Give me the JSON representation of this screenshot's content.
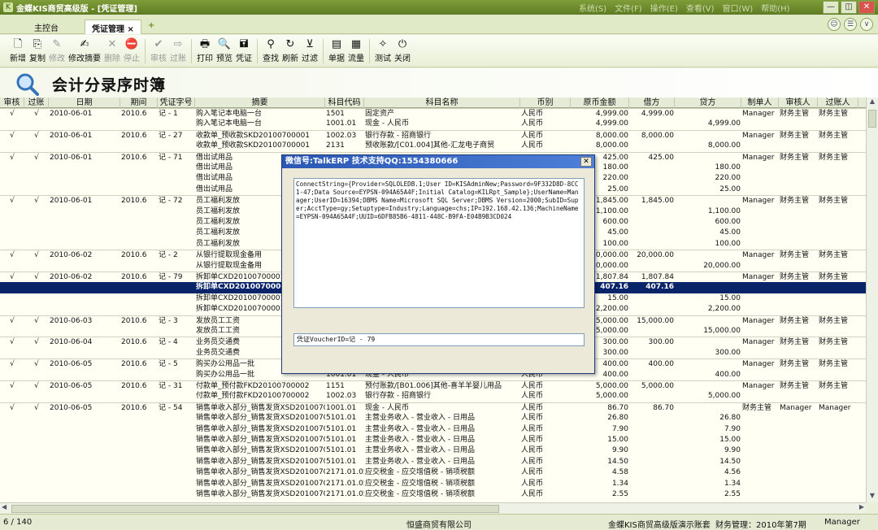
{
  "app": {
    "title": "金蝶KIS商贸高级版 - [凭证管理]",
    "logo": "K",
    "menus": [
      "系统(S)",
      "文件(F)",
      "操作(E)",
      "查看(V)",
      "窗口(W)",
      "帮助(H)"
    ],
    "win_buttons": [
      "—",
      "◫",
      "✕"
    ]
  },
  "tabs": [
    {
      "label": "主控台"
    },
    {
      "label": "凭证管理 ×"
    },
    {
      "label": "+"
    }
  ],
  "tab_icons": [
    "☺",
    "☰",
    "∨"
  ],
  "toolbar": [
    {
      "icon": "🗋",
      "label": "新增",
      "enabled": true
    },
    {
      "icon": "⎘",
      "label": "复制",
      "enabled": true
    },
    {
      "icon": "✎",
      "label": "修改",
      "enabled": false
    },
    {
      "icon": "✍",
      "label": "修改摘要",
      "enabled": true
    },
    {
      "icon": "✕",
      "label": "删除",
      "enabled": false
    },
    {
      "icon": "⛔",
      "label": "停止",
      "enabled": false
    },
    {
      "icon": "✔",
      "label": "审核",
      "enabled": false
    },
    {
      "icon": "⇨",
      "label": "过账",
      "enabled": false
    },
    {
      "icon": "🖶",
      "label": "打印",
      "enabled": true
    },
    {
      "icon": "🔍",
      "label": "预览",
      "enabled": true
    },
    {
      "icon": "🖬",
      "label": "凭证",
      "enabled": true
    },
    {
      "icon": "⚲",
      "label": "查找",
      "enabled": true
    },
    {
      "icon": "↻",
      "label": "刷新",
      "enabled": true
    },
    {
      "icon": "⊻",
      "label": "过滤",
      "enabled": true
    },
    {
      "icon": "▤",
      "label": "单据",
      "enabled": true
    },
    {
      "icon": "▦",
      "label": "流量",
      "enabled": true
    },
    {
      "icon": "✧",
      "label": "测试",
      "enabled": true
    },
    {
      "icon": "⏻",
      "label": "关闭",
      "enabled": true
    }
  ],
  "page_title": "会计分录序时簿",
  "columns": [
    "审核",
    "过账",
    "日期",
    "期间",
    "凭证字号",
    "摘要",
    "科目代码",
    "科目名称",
    "币别",
    "原币金额",
    "借方",
    "贷方",
    "制单人",
    "审核人",
    "过账人"
  ],
  "rows": [
    {
      "sep": true,
      "audit": "√",
      "post": "√",
      "date": "2010-06-01",
      "period": "2010.6",
      "voucher": "记 - 1",
      "summary": "购入笔记本电脑一台",
      "code": "1501",
      "name": "固定资产",
      "cur": "人民币",
      "amount": "4,999.00",
      "debit": "4,999.00",
      "credit": "",
      "maker": "Manager",
      "auditor": "财务主管",
      "poster": "财务主管"
    },
    {
      "summary": "购入笔记本电脑一台",
      "code": "1001.01",
      "name": "现金 - 人民币",
      "cur": "人民币",
      "amount": "4,999.00",
      "credit": "4,999.00"
    },
    {
      "sep": true,
      "audit": "√",
      "post": "√",
      "date": "2010-06-01",
      "period": "2010.6",
      "voucher": "记 - 27",
      "summary": "收款单_预收款SKD20100700001",
      "code": "1002.03",
      "name": "银行存款 - 招商银行",
      "cur": "人民币",
      "amount": "8,000.00",
      "debit": "8,000.00",
      "maker": "Manager",
      "auditor": "财务主管",
      "poster": "财务主管"
    },
    {
      "summary": "收款单_预收款SKD20100700001",
      "code": "2131",
      "name": "预收账款/[C01.004]其他-汇龙电子商贸",
      "cur": "人民币",
      "amount": "8,000.00",
      "credit": "8,000.00"
    },
    {
      "sep": true,
      "audit": "√",
      "post": "√",
      "date": "2010-06-01",
      "period": "2010.6",
      "voucher": "记 - 71",
      "summary": "借出试用品",
      "amount": "425.00",
      "debit": "425.00",
      "maker": "Manager",
      "auditor": "财务主管",
      "poster": "财务主管"
    },
    {
      "summary": "借出试用品",
      "amount": "180.00",
      "credit": "180.00"
    },
    {
      "summary": "借出试用品",
      "amount": "220.00",
      "credit": "220.00"
    },
    {
      "summary": "借出试用品",
      "amount": "25.00",
      "credit": "25.00"
    },
    {
      "sep": true,
      "audit": "√",
      "post": "√",
      "date": "2010-06-01",
      "period": "2010.6",
      "voucher": "记 - 72",
      "summary": "员工福利发放",
      "amount": "1,845.00",
      "debit": "1,845.00",
      "maker": "Manager",
      "auditor": "财务主管",
      "poster": "财务主管"
    },
    {
      "summary": "员工福利发放",
      "amount": "1,100.00",
      "credit": "1,100.00"
    },
    {
      "summary": "员工福利发放",
      "amount": "600.00",
      "credit": "600.00"
    },
    {
      "summary": "员工福利发放",
      "amount": "45.00",
      "credit": "45.00"
    },
    {
      "summary": "员工福利发放",
      "amount": "100.00",
      "credit": "100.00"
    },
    {
      "sep": true,
      "audit": "√",
      "post": "√",
      "date": "2010-06-02",
      "period": "2010.6",
      "voucher": "记 - 2",
      "summary": "从银行提取现金备用",
      "amount": "20,000.00",
      "debit": "20,000.00",
      "maker": "Manager",
      "auditor": "财务主管",
      "poster": "财务主管"
    },
    {
      "summary": "从银行提取现金备用",
      "amount": "20,000.00",
      "credit": "20,000.00"
    },
    {
      "sep": true,
      "audit": "√",
      "post": "√",
      "date": "2010-06-02",
      "period": "2010.6",
      "voucher": "记 - 79",
      "summary": "拆卸单CXD20100700001",
      "amount": "1,807.84",
      "debit": "1,807.84",
      "maker": "Manager",
      "auditor": "财务主管",
      "poster": "财务主管"
    },
    {
      "sel": true,
      "summary": "拆卸单CXD20100700001",
      "amount": "407.16",
      "debit": "407.16"
    },
    {
      "summary": "拆卸单CXD20100700001",
      "amount": "15.00",
      "credit": "15.00"
    },
    {
      "summary": "拆卸单CXD20100700001",
      "amount": "2,200.00",
      "credit": "2,200.00"
    },
    {
      "sep": true,
      "audit": "√",
      "post": "√",
      "date": "2010-06-03",
      "period": "2010.6",
      "voucher": "记 - 3",
      "summary": "发放员工工资",
      "amount": "15,000.00",
      "debit": "15,000.00",
      "maker": "Manager",
      "auditor": "财务主管",
      "poster": "财务主管"
    },
    {
      "summary": "发放员工工资",
      "amount": "15,000.00",
      "credit": "15,000.00"
    },
    {
      "sep": true,
      "audit": "√",
      "post": "√",
      "date": "2010-06-04",
      "period": "2010.6",
      "voucher": "记 - 4",
      "summary": "业务员交通费",
      "amount": "300.00",
      "debit": "300.00",
      "maker": "Manager",
      "auditor": "财务主管",
      "poster": "财务主管"
    },
    {
      "summary": "业务员交通费",
      "amount": "300.00",
      "credit": "300.00"
    },
    {
      "sep": true,
      "audit": "√",
      "post": "√",
      "date": "2010-06-05",
      "period": "2010.6",
      "voucher": "记 - 5",
      "summary": "购买办公用品一批",
      "amount": "400.00",
      "debit": "400.00",
      "maker": "Manager",
      "auditor": "财务主管",
      "poster": "财务主管"
    },
    {
      "summary": "购买办公用品一批",
      "code": "1001.01",
      "name": "现金 - 人民币",
      "cur": "人民币",
      "amount": "400.00",
      "credit": "400.00"
    },
    {
      "sep": true,
      "audit": "√",
      "post": "√",
      "date": "2010-06-05",
      "period": "2010.6",
      "voucher": "记 - 31",
      "summary": "付款单_预付款FKD20100700002",
      "code": "1151",
      "name": "预付账款/[B01.006]其他-喜羊羊婴儿用品",
      "cur": "人民币",
      "amount": "5,000.00",
      "debit": "5,000.00",
      "maker": "Manager",
      "auditor": "财务主管",
      "poster": "财务主管"
    },
    {
      "summary": "付款单_预付款FKD20100700002",
      "code": "1002.03",
      "name": "银行存款 - 招商银行",
      "cur": "人民币",
      "amount": "5,000.00",
      "credit": "5,000.00"
    },
    {
      "sep": true,
      "audit": "√",
      "post": "√",
      "date": "2010-06-05",
      "period": "2010.6",
      "voucher": "记 - 54",
      "summary": "销售单收入部分_销售发货XSD20100700001",
      "code": "1001.01",
      "name": "现金 - 人民币",
      "cur": "人民币",
      "amount": "86.70",
      "debit": "86.70",
      "maker": "财务主管",
      "auditor": "Manager",
      "poster": "Manager"
    },
    {
      "summary": "销售单收入部分_销售发货XSD20100700001",
      "code": "5101.01",
      "name": "主营业务收入 - 营业收入 - 日用品",
      "cur": "人民币",
      "amount": "26.80",
      "credit": "26.80"
    },
    {
      "summary": "销售单收入部分_销售发货XSD20100700001",
      "code": "5101.01",
      "name": "主营业务收入 - 营业收入 - 日用品",
      "cur": "人民币",
      "amount": "7.90",
      "credit": "7.90"
    },
    {
      "summary": "销售单收入部分_销售发货XSD20100700001",
      "code": "5101.01",
      "name": "主营业务收入 - 营业收入 - 日用品",
      "cur": "人民币",
      "amount": "15.00",
      "credit": "15.00"
    },
    {
      "summary": "销售单收入部分_销售发货XSD20100700001",
      "code": "5101.01",
      "name": "主营业务收入 - 营业收入 - 日用品",
      "cur": "人民币",
      "amount": "9.90",
      "credit": "9.90"
    },
    {
      "summary": "销售单收入部分_销售发货XSD20100700001",
      "code": "5101.01",
      "name": "主营业务收入 - 营业收入 - 日用品",
      "cur": "人民币",
      "amount": "14.50",
      "credit": "14.50"
    },
    {
      "summary": "销售单收入部分_销售发货XSD20100700001",
      "code": "2171.01.05",
      "name": "应交税金 - 应交增值税 - 销项税额",
      "cur": "人民币",
      "amount": "4.58",
      "credit": "4.56"
    },
    {
      "summary": "销售单收入部分_销售发货XSD20100700001",
      "code": "2171.01.05",
      "name": "应交税金 - 应交增值税 - 销项税额",
      "cur": "人民币",
      "amount": "1.34",
      "credit": "1.34"
    },
    {
      "summary": "销售单收入部分_销售发货XSD20100700001",
      "code": "2171.01.05",
      "name": "应交税金 - 应交增值税 - 销项税额",
      "cur": "人民币",
      "amount": "2.55",
      "credit": "2.55"
    }
  ],
  "dialog": {
    "title": "微信号:TalkERP    技术支持QQ:1554380666",
    "close": "✕",
    "conn_text": "ConnectString={Provider=SQLOLEDB.1;User ID=KISAdminNew;Password=9F332D8D-8CC1-47;Data Source=EYPSN-094A65A4F;Initial Catalog=KILRpt_Sample};UserName=Manager;UserID=16394;DBMS Name=Microsoft SQL Server;DBMS Version=2000;SubID=Super;AcctType=gy;Setuptype=Industry;Language=chs;IP=192.168.42.136;MachineName=EYPSN-094A65A4F;UUID=6DFB85B6-4811-448C-B9FA-E04B9B3CD024",
    "voucher_text": "凭证VoucherID=记 - 79"
  },
  "status": {
    "page": "6 / 140",
    "company": "恒盛商贸有限公司",
    "edition": "金蝶KIS商贸高级版演示账套",
    "period": "财务管理：2010年第7期",
    "user": "Manager"
  },
  "scroll": {
    "up": "▲",
    "down": "▼",
    "left": "◀",
    "right": "▶"
  }
}
